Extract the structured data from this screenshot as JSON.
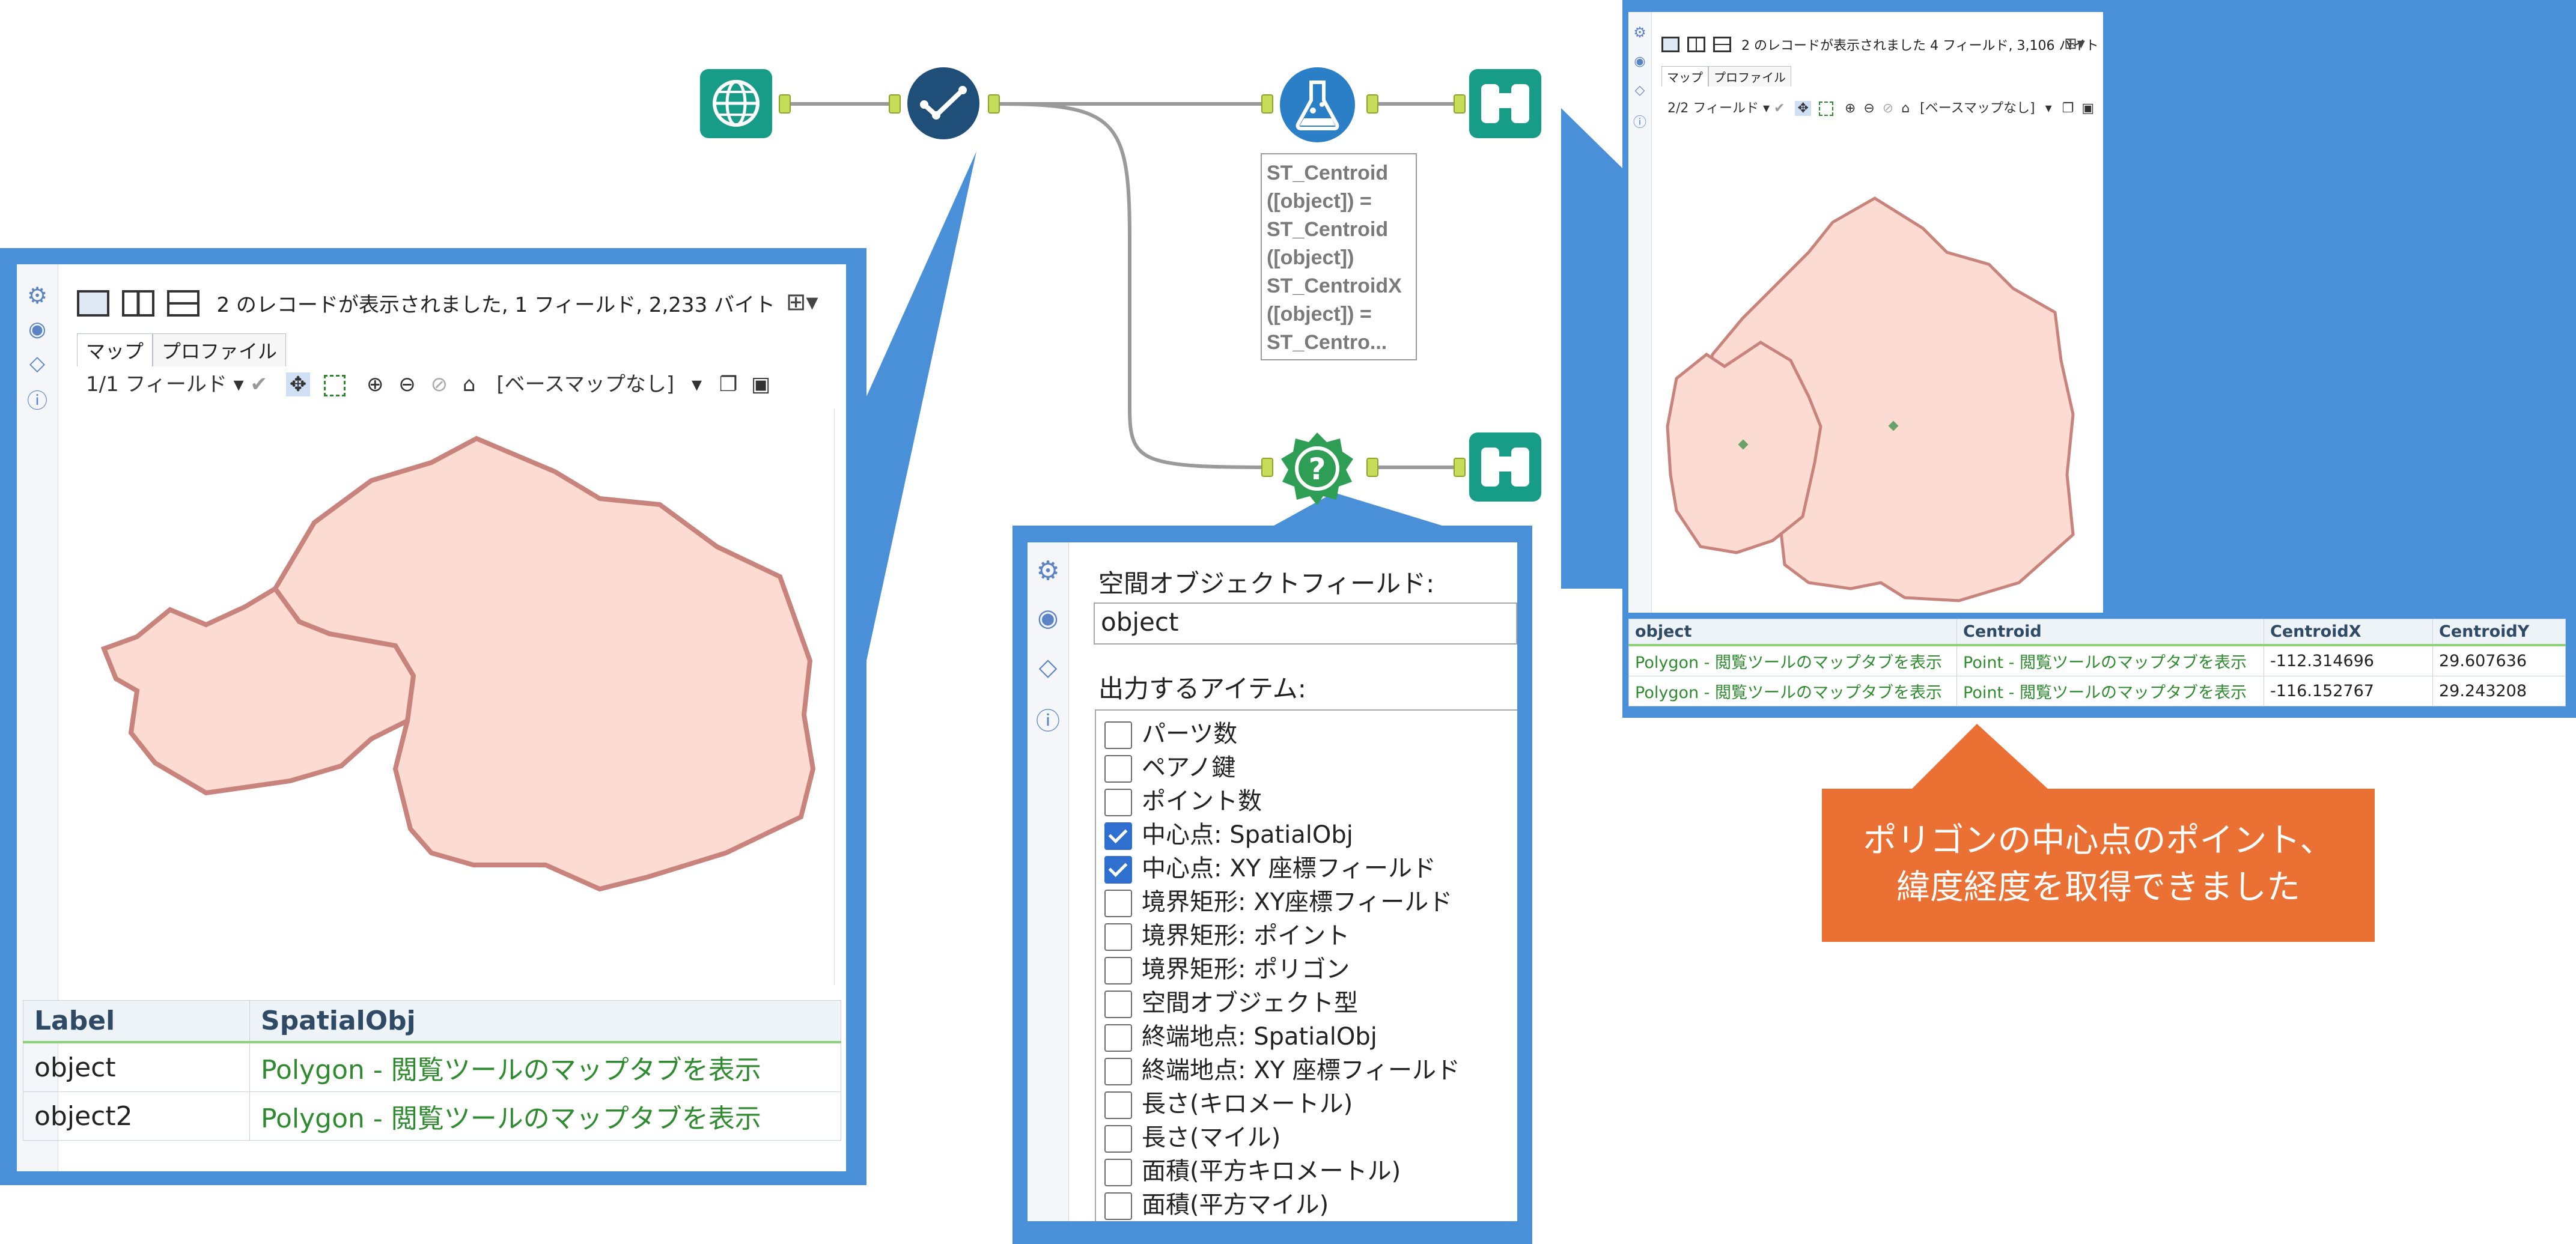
{
  "workflow": {
    "formula_lines": [
      "ST_Centroid",
      "([object]) =",
      "ST_Centroid",
      "([object])",
      "ST_CentroidX",
      "([object]) =",
      "ST_Centro..."
    ]
  },
  "left_browse": {
    "status": "2 のレコードが表示されました, 1 フィールド, 2,233 バイト",
    "tabs": [
      "マップ",
      "プロファイル"
    ],
    "field_selector": "1/1 フィールド",
    "basemap": "[ベースマップなし]",
    "table": {
      "headers": [
        "Label",
        "SpatialObj"
      ],
      "rows": [
        [
          "object",
          "Polygon - 閲覧ツールのマップタブを表示"
        ],
        [
          "object2",
          "Polygon - 閲覧ツールのマップタブを表示"
        ]
      ]
    }
  },
  "right_browse": {
    "status": "2 のレコードが表示されました 4 フィールド, 3,106 バイト",
    "tabs": [
      "マップ",
      "プロファイル"
    ],
    "field_selector": "2/2 フィールド",
    "basemap": "[ベースマップなし]",
    "table": {
      "headers": [
        "object",
        "Centroid",
        "CentroidX",
        "CentroidY"
      ],
      "rows": [
        [
          "Polygon - 閲覧ツールのマップタブを表示",
          "Point - 閲覧ツールのマップタブを表示",
          "-112.314696",
          "29.607636"
        ],
        [
          "Polygon - 閲覧ツールのマップタブを表示",
          "Point - 閲覧ツールのマップタブを表示",
          "-116.152767",
          "29.243208"
        ]
      ]
    }
  },
  "spatial_info_config": {
    "field_label": "空間オブジェクトフィールド:",
    "field_value": "object",
    "items_label": "出力するアイテム:",
    "items": [
      {
        "label": "パーツ数",
        "checked": false
      },
      {
        "label": "ペアノ鍵",
        "checked": false
      },
      {
        "label": "ポイント数",
        "checked": false
      },
      {
        "label": "中心点: SpatialObj",
        "checked": true
      },
      {
        "label": "中心点: XY 座標フィールド",
        "checked": true
      },
      {
        "label": "境界矩形: XY座標フィールド",
        "checked": false
      },
      {
        "label": "境界矩形: ポイント",
        "checked": false
      },
      {
        "label": "境界矩形: ポリゴン",
        "checked": false
      },
      {
        "label": "空間オブジェクト型",
        "checked": false
      },
      {
        "label": "終端地点: SpatialObj",
        "checked": false
      },
      {
        "label": "終端地点: XY 座標フィールド",
        "checked": false
      },
      {
        "label": "長さ(キロメートル)",
        "checked": false
      },
      {
        "label": "長さ(マイル)",
        "checked": false
      },
      {
        "label": "面積(平方キロメートル)",
        "checked": false
      },
      {
        "label": "面積(平方マイル)",
        "checked": false
      }
    ]
  },
  "callout": {
    "line1": "ポリゴンの中心点のポイント、",
    "line2": "緯度経度を取得できました"
  },
  "colors": {
    "accent_blue": "#4a90d9",
    "tool_teal": "#169c87",
    "tool_navy": "#1f4e79",
    "tool_blue": "#2a7fc7",
    "tool_green": "#2f9e55",
    "callout_orange": "#ea7034",
    "polygon_fill": "#fcdcd2",
    "polygon_stroke": "#c8847c"
  },
  "icons": [
    "globe-icon",
    "checkmark-icon",
    "flask-icon",
    "binoculars-icon",
    "question-badge-icon",
    "gear-icon",
    "tag-icon",
    "help-icon"
  ]
}
